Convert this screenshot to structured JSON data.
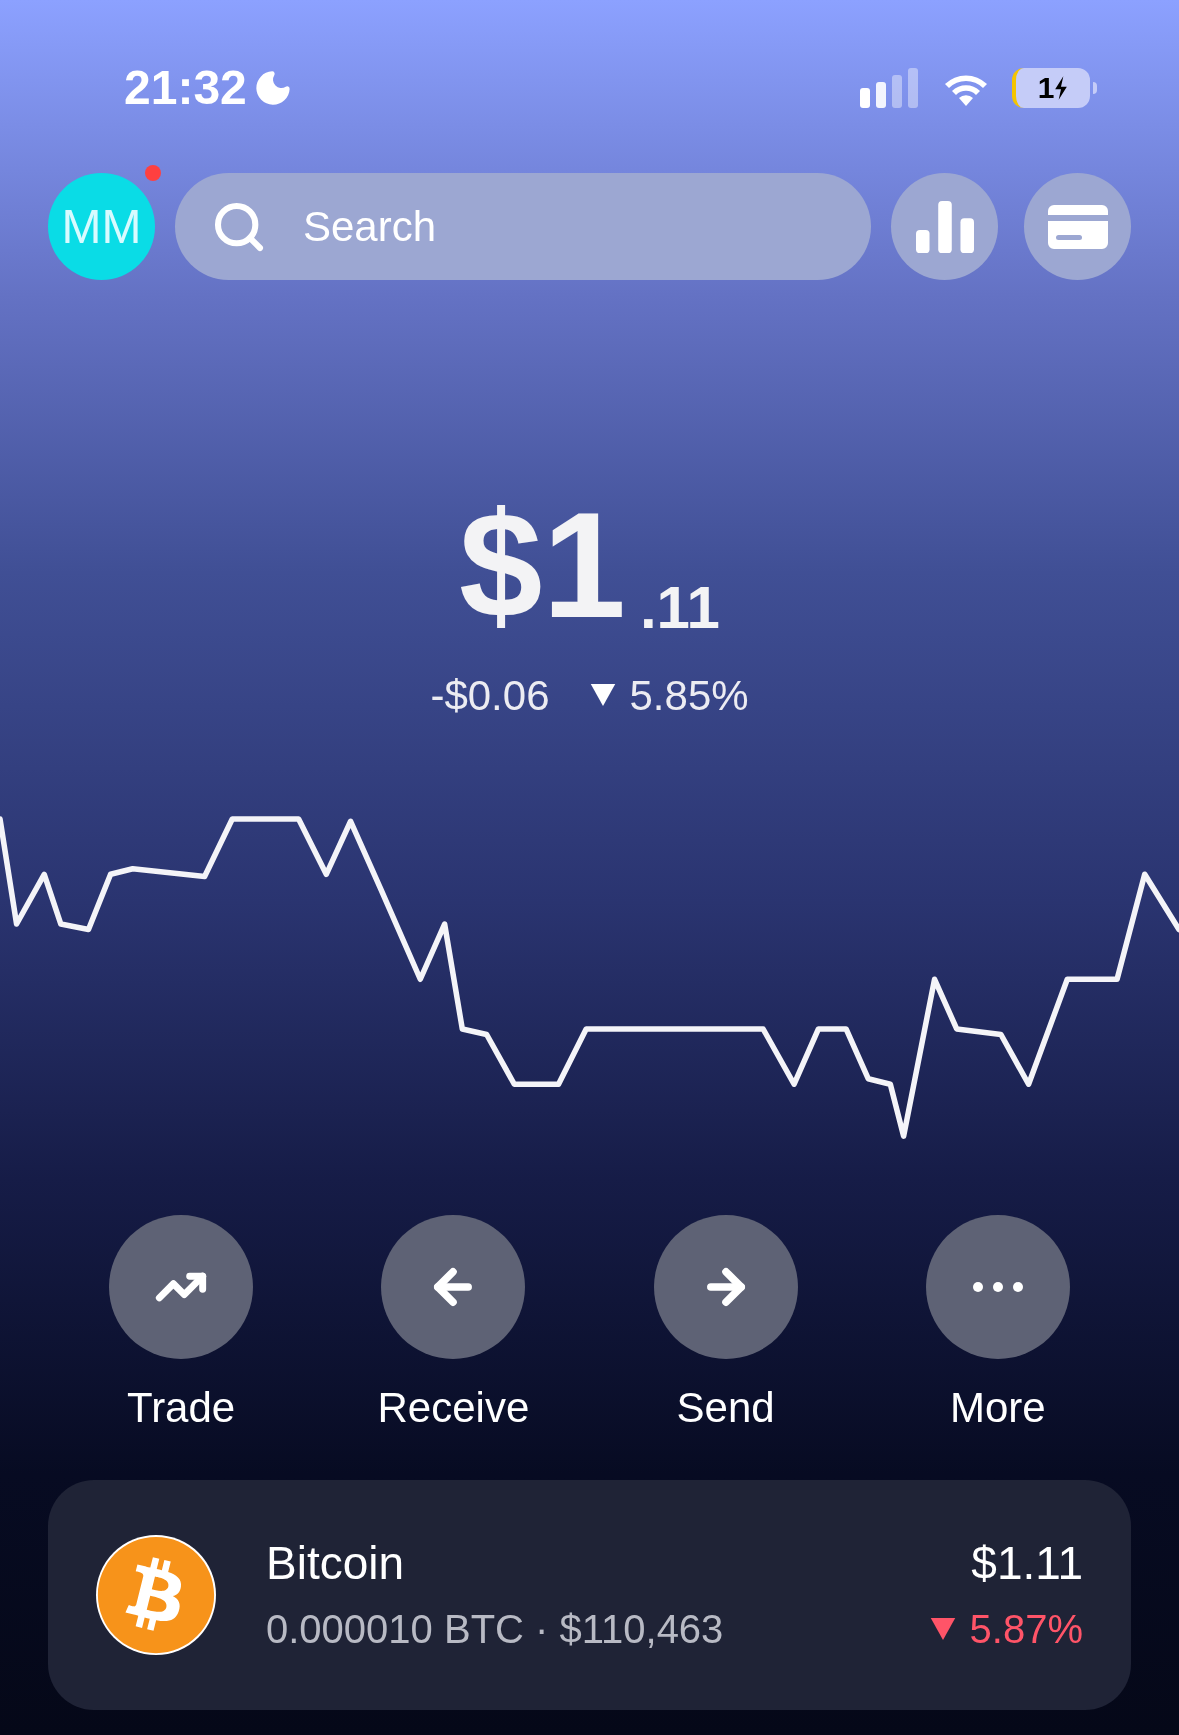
{
  "status_bar": {
    "time": "21:32",
    "battery": "1"
  },
  "header": {
    "avatar": {
      "initials": "MM",
      "has_notification": true
    },
    "search": {
      "placeholder": "Search"
    }
  },
  "balance": {
    "whole": "$1",
    "cents": ".11",
    "change": "-$0.06",
    "change_percent": "5.85%",
    "negative": true
  },
  "actions": [
    {
      "kind": "trade",
      "label": "Trade"
    },
    {
      "kind": "receive",
      "label": "Receive"
    },
    {
      "kind": "send",
      "label": "Send"
    },
    {
      "kind": "more",
      "label": "More"
    }
  ],
  "asset": {
    "name": "Bitcoin",
    "holding": "0.000010 BTC · $110,463",
    "value": "$1.11",
    "change_percent": "5.87%",
    "negative": true
  }
}
